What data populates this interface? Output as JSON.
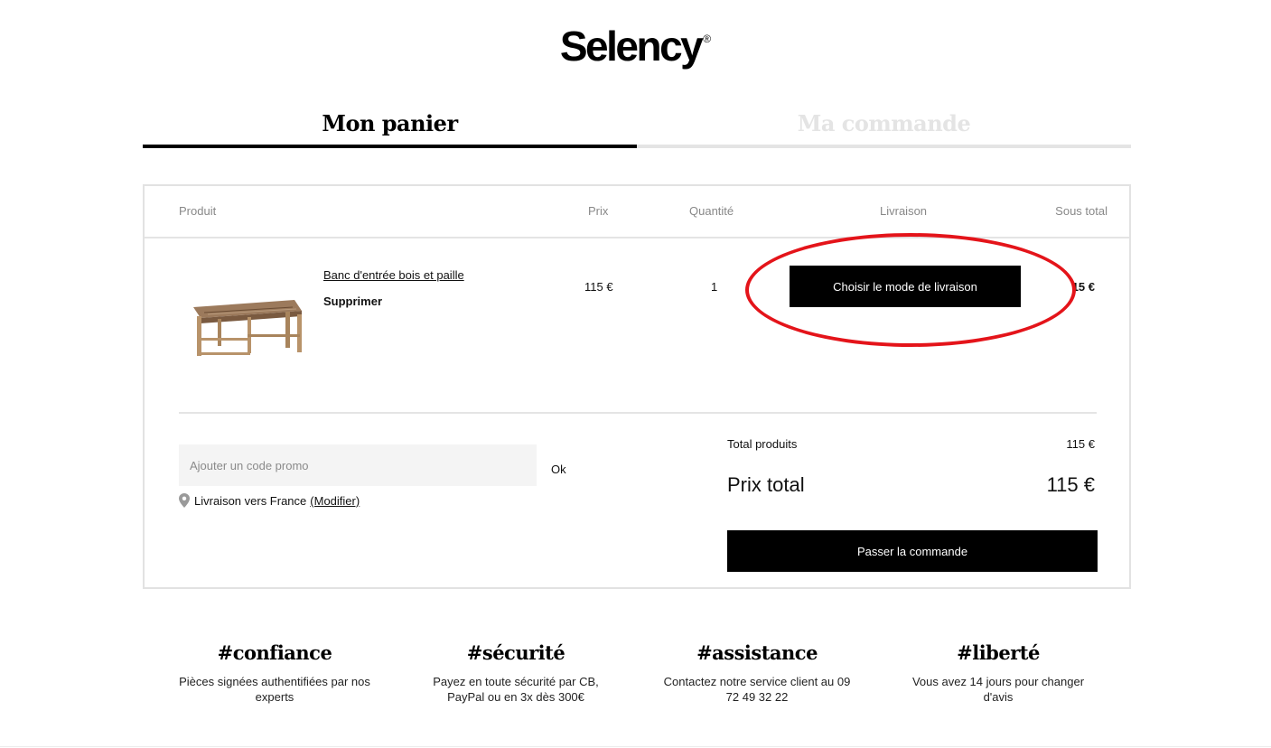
{
  "brand": {
    "name": "Selency",
    "registered": "®"
  },
  "steps": [
    {
      "label": "Mon panier",
      "active": true
    },
    {
      "label": "Ma commande",
      "active": false
    }
  ],
  "table": {
    "headers": {
      "produit": "Produit",
      "prix": "Prix",
      "quantite": "Quantité",
      "livraison": "Livraison",
      "sous_total": "Sous total"
    }
  },
  "item": {
    "name": "Banc d'entrée bois et paille",
    "remove_label": "Supprimer",
    "price": "115 €",
    "quantity": "1",
    "delivery_button": "Choisir le mode de livraison",
    "subtotal": "15 €"
  },
  "promo": {
    "placeholder": "Ajouter un code promo",
    "ok_label": "Ok"
  },
  "shipping": {
    "text": "Livraison vers France",
    "modify_label": "(Modifier)"
  },
  "totals": {
    "products_label": "Total produits",
    "products_value": "115 €",
    "total_label": "Prix total",
    "total_value": "115 €",
    "checkout_button": "Passer la commande"
  },
  "features": [
    {
      "title": "#confiance",
      "text": "Pièces signées authentifiées par nos experts"
    },
    {
      "title": "#sécurité",
      "text": "Payez en toute sécurité par CB, PayPal ou en 3x dès 300€"
    },
    {
      "title": "#assistance",
      "text": "Contactez notre service client au 09 72 49 32 22"
    },
    {
      "title": "#liberté",
      "text": "Vous avez 14 jours pour changer d'avis"
    }
  ],
  "colors": {
    "accent_annotation": "#e4141a",
    "button_bg": "#000000",
    "inactive_step": "#e4e4e4"
  },
  "icons": {
    "location": "map-pin-icon",
    "product": "bench-image"
  }
}
